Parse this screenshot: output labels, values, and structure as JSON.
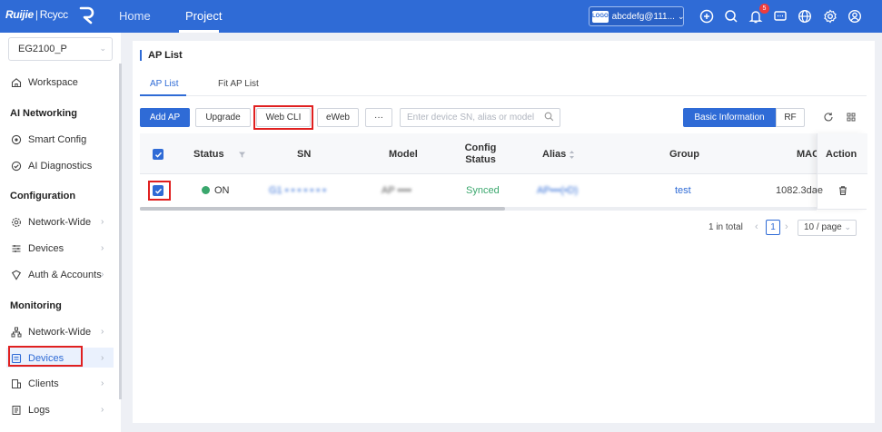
{
  "header": {
    "logo_brand": "Ruijie",
    "logo_sep": "|",
    "logo_product": "Rcycc",
    "nav": [
      {
        "label": "Home"
      },
      {
        "label": "Project"
      }
    ],
    "account": {
      "logo_text": "LOGO",
      "name": "abcdefg@111..."
    },
    "notification_count": "5",
    "icons": [
      "add-circle-icon",
      "search-icon",
      "bell-icon",
      "message-icon",
      "globe-icon",
      "gear-icon",
      "user-icon"
    ]
  },
  "sidebar": {
    "site": "EG2100_P",
    "workspace": "Workspace",
    "groups": [
      {
        "title": "AI Networking",
        "items": [
          {
            "label": "Smart Config"
          },
          {
            "label": "AI Diagnostics"
          }
        ]
      },
      {
        "title": "Configuration",
        "items": [
          {
            "label": "Network-Wide"
          },
          {
            "label": "Devices"
          },
          {
            "label": "Auth & Accounts"
          }
        ]
      },
      {
        "title": "Monitoring",
        "items": [
          {
            "label": "Network-Wide"
          },
          {
            "label": "Devices"
          },
          {
            "label": "Clients"
          },
          {
            "label": "Logs"
          }
        ]
      }
    ]
  },
  "main": {
    "title": "AP List",
    "tabs": [
      {
        "label": "AP List"
      },
      {
        "label": "Fit AP List"
      }
    ],
    "toolbar": {
      "add": "Add AP",
      "upgrade": "Upgrade",
      "webcli": "Web CLI",
      "eweb": "eWeb",
      "more": "···",
      "search_placeholder": "Enter device SN, alias or model",
      "view_basic": "Basic Information",
      "view_rf": "RF"
    },
    "table": {
      "columns": {
        "status": "Status",
        "sn": "SN",
        "model": "Model",
        "config_status_1": "Config",
        "config_status_2": "Status",
        "alias": "Alias",
        "group": "Group",
        "mac": "MAC",
        "action": "Action"
      },
      "rows": [
        {
          "status": "ON",
          "sn": "G1 • • • • • • •",
          "model": "AP ••••",
          "config_status": "Synced",
          "alias": "AP•••(•D)",
          "group": "test",
          "mac": "1082.3dae"
        }
      ]
    },
    "pagination": {
      "total": "1 in total",
      "page": "1",
      "page_size": "10 / page"
    }
  },
  "colors": {
    "primary": "#2f6bd6",
    "online": "#3aa76d",
    "highlight": "#e02020"
  }
}
